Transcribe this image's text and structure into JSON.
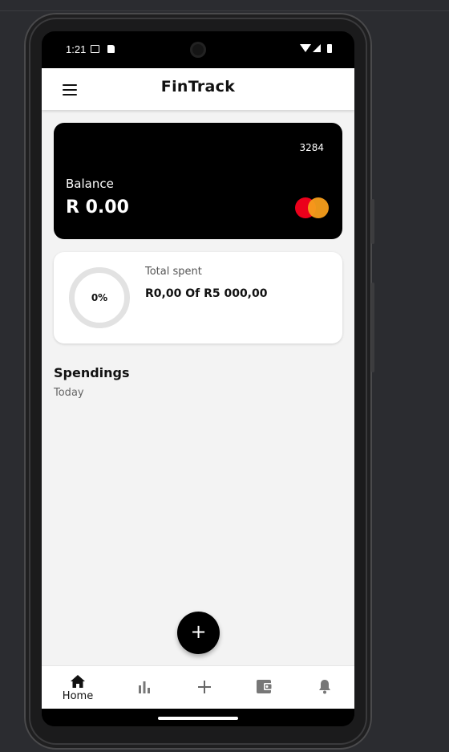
{
  "status_bar": {
    "time": "1:21"
  },
  "app_bar": {
    "title": "FinTrack",
    "menu_icon": "hamburger-menu-icon"
  },
  "balance_card": {
    "card_number": "3284",
    "label": "Balance",
    "value": "R 0.00",
    "brand_icon": "mastercard-logo"
  },
  "spent_card": {
    "progress_text": "0%",
    "progress_fraction": 0,
    "label": "Total spent",
    "value": "R0,00 Of R5 000,00"
  },
  "spendings": {
    "title": "Spendings",
    "subtitle": "Today"
  },
  "fab": {
    "icon": "plus-icon",
    "symbol": "+"
  },
  "bottom_nav": {
    "items": [
      {
        "icon": "home-icon",
        "label": "Home",
        "active": true
      },
      {
        "icon": "bar-chart-icon",
        "label": "",
        "active": false
      },
      {
        "icon": "plus-icon",
        "label": "",
        "active": false
      },
      {
        "icon": "wallet-icon",
        "label": "",
        "active": false
      },
      {
        "icon": "bell-icon",
        "label": "",
        "active": false
      }
    ]
  },
  "colors": {
    "background": "#2b2c30",
    "card": "#000000",
    "app_background": "#f3f3f3",
    "mastercard_red": "#eb001b",
    "mastercard_orange": "#f79e1b"
  }
}
